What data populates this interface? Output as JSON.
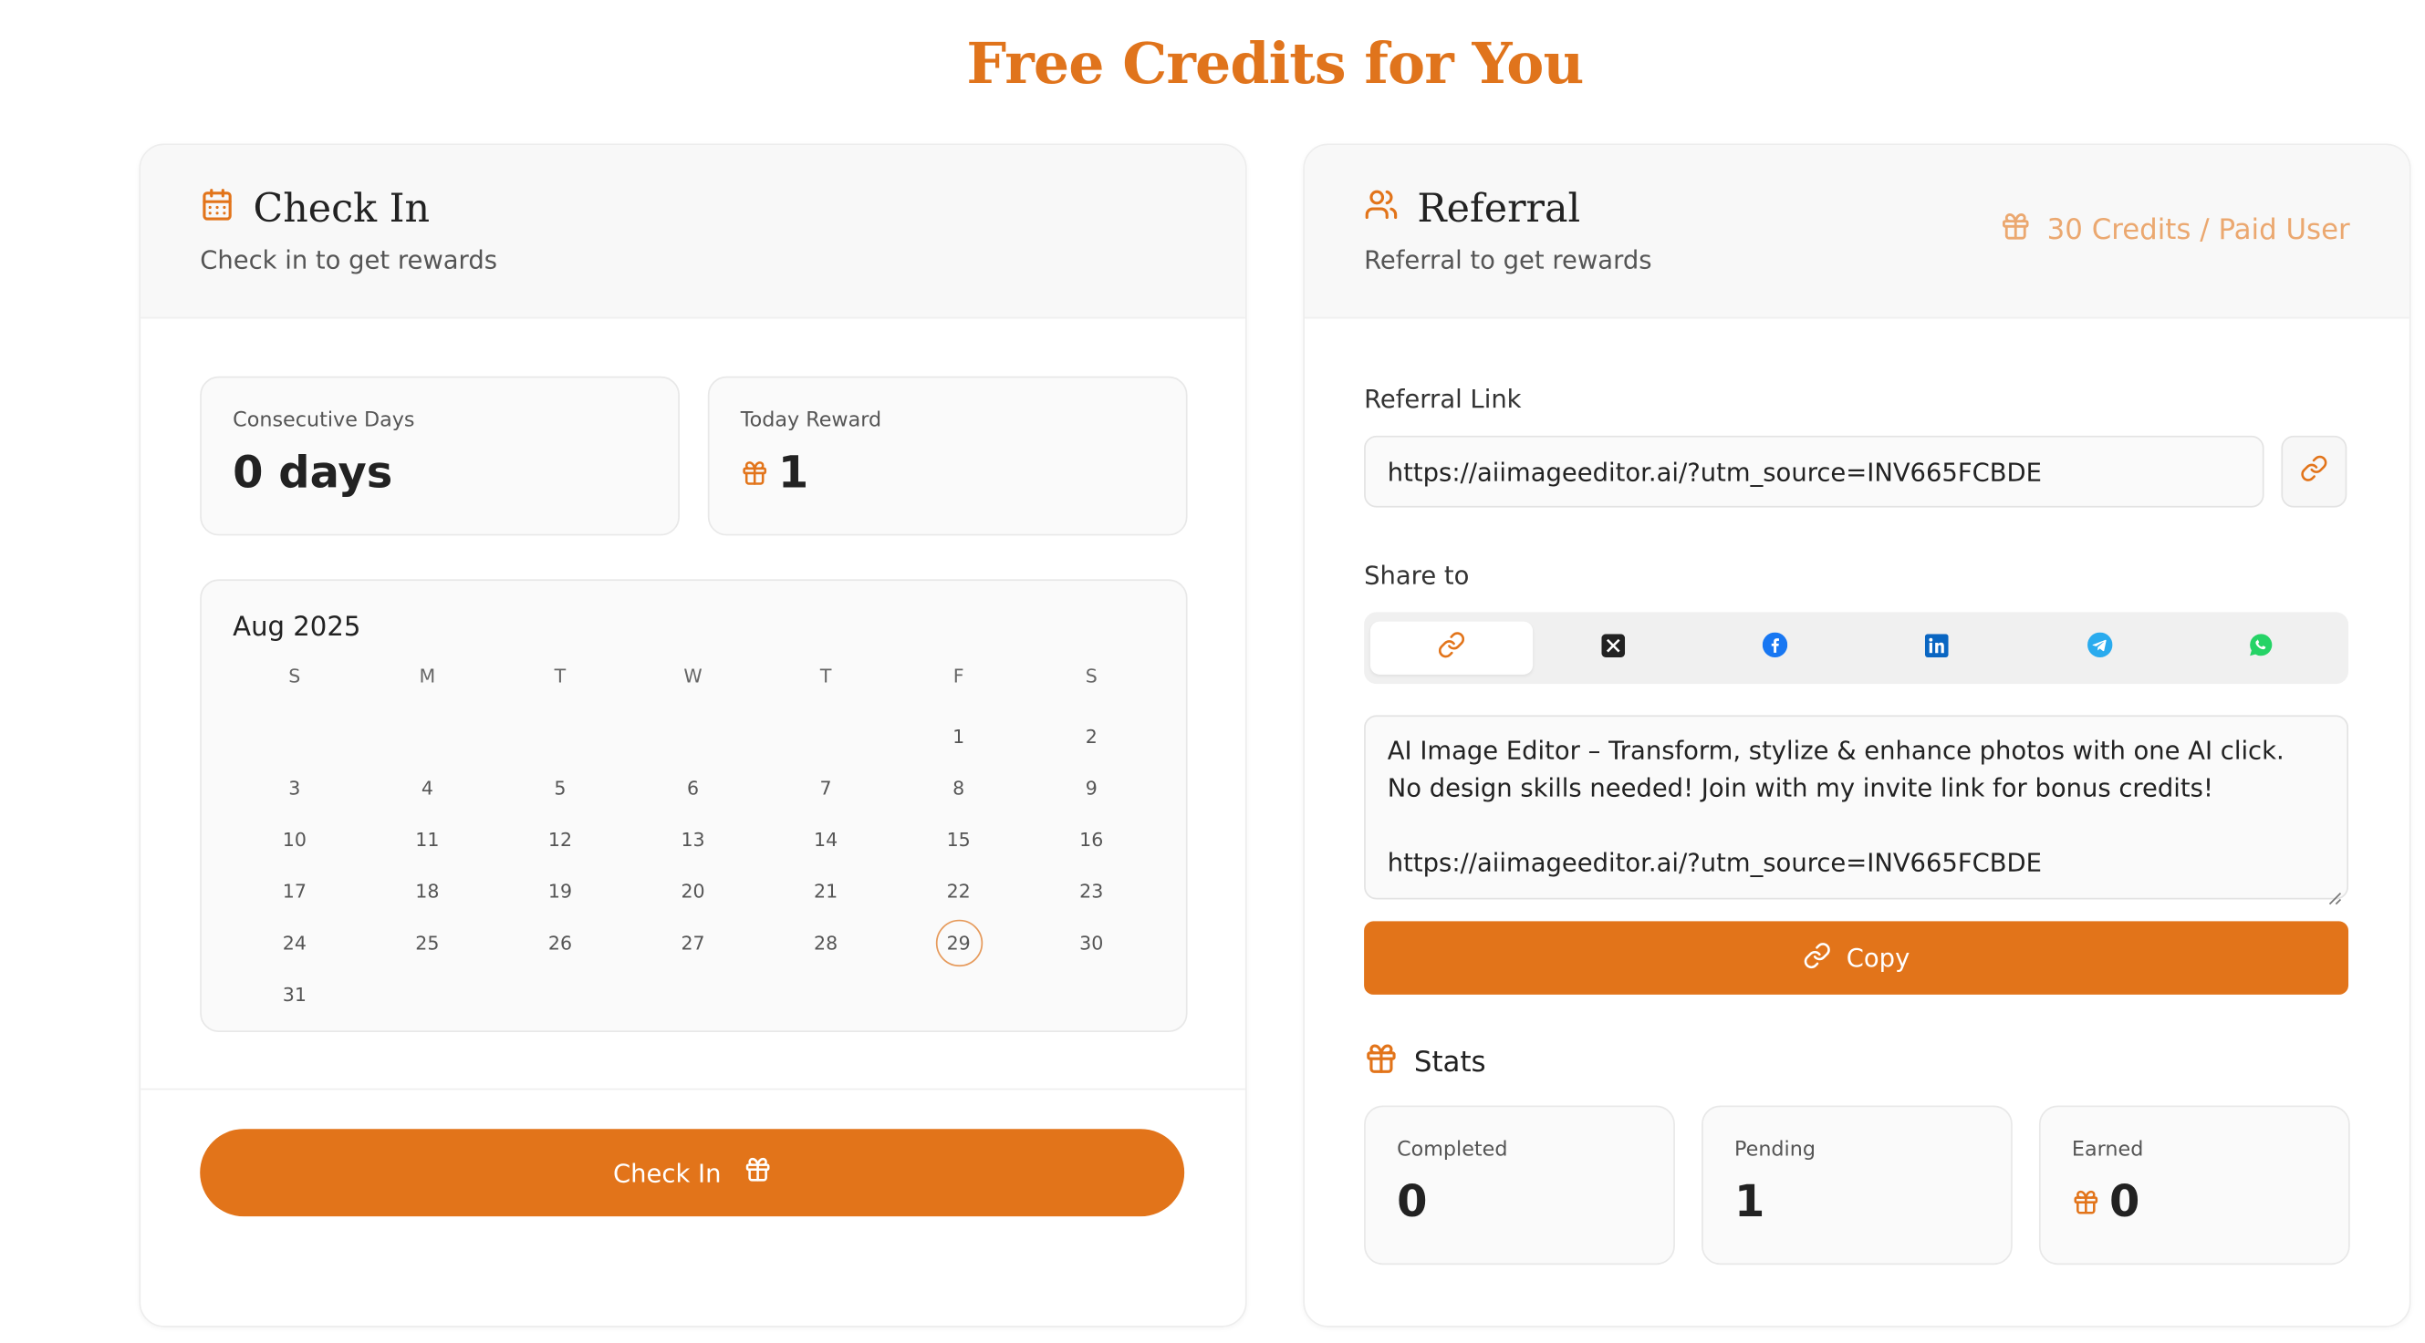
{
  "page": {
    "title": "Free Credits for You"
  },
  "checkin": {
    "title": "Check In",
    "subtitle": "Check in to get rewards",
    "consecutive_label": "Consecutive Days",
    "consecutive_value": "0 days",
    "today_label": "Today Reward",
    "today_value": "1",
    "calendar": {
      "month": "Aug 2025",
      "weekdays": [
        "S",
        "M",
        "T",
        "W",
        "T",
        "F",
        "S"
      ],
      "first_weekday_index": 5,
      "days_in_month": 31,
      "today": 29
    },
    "button_label": "Check In"
  },
  "referral": {
    "title": "Referral",
    "subtitle": "Referral to get rewards",
    "badge": "30 Credits / Paid User",
    "link_label": "Referral Link",
    "link_value": "https://aiimageeditor.ai/?utm_source=INV665FCBDE",
    "share_label": "Share to",
    "share_targets": [
      "link-icon",
      "x-icon",
      "facebook-icon",
      "linkedin-icon",
      "telegram-icon",
      "whatsapp-icon"
    ],
    "share_text": "AI Image Editor – Transform, stylize & enhance photos with one AI click. No design skills needed! Join with my invite link for bonus credits!\n\nhttps://aiimageeditor.ai/?utm_source=INV665FCBDE",
    "copy_label": "Copy",
    "stats_title": "Stats",
    "stats": {
      "completed_label": "Completed",
      "completed_value": "0",
      "pending_label": "Pending",
      "pending_value": "1",
      "earned_label": "Earned",
      "earned_value": "0"
    }
  },
  "colors": {
    "accent": "#e2741a",
    "accent_light": "#eba870",
    "x_brand": "#222222",
    "facebook_brand": "#1877f2",
    "linkedin_brand": "#0a66c2",
    "telegram_brand": "#2aabee",
    "whatsapp_brand": "#25d366"
  }
}
